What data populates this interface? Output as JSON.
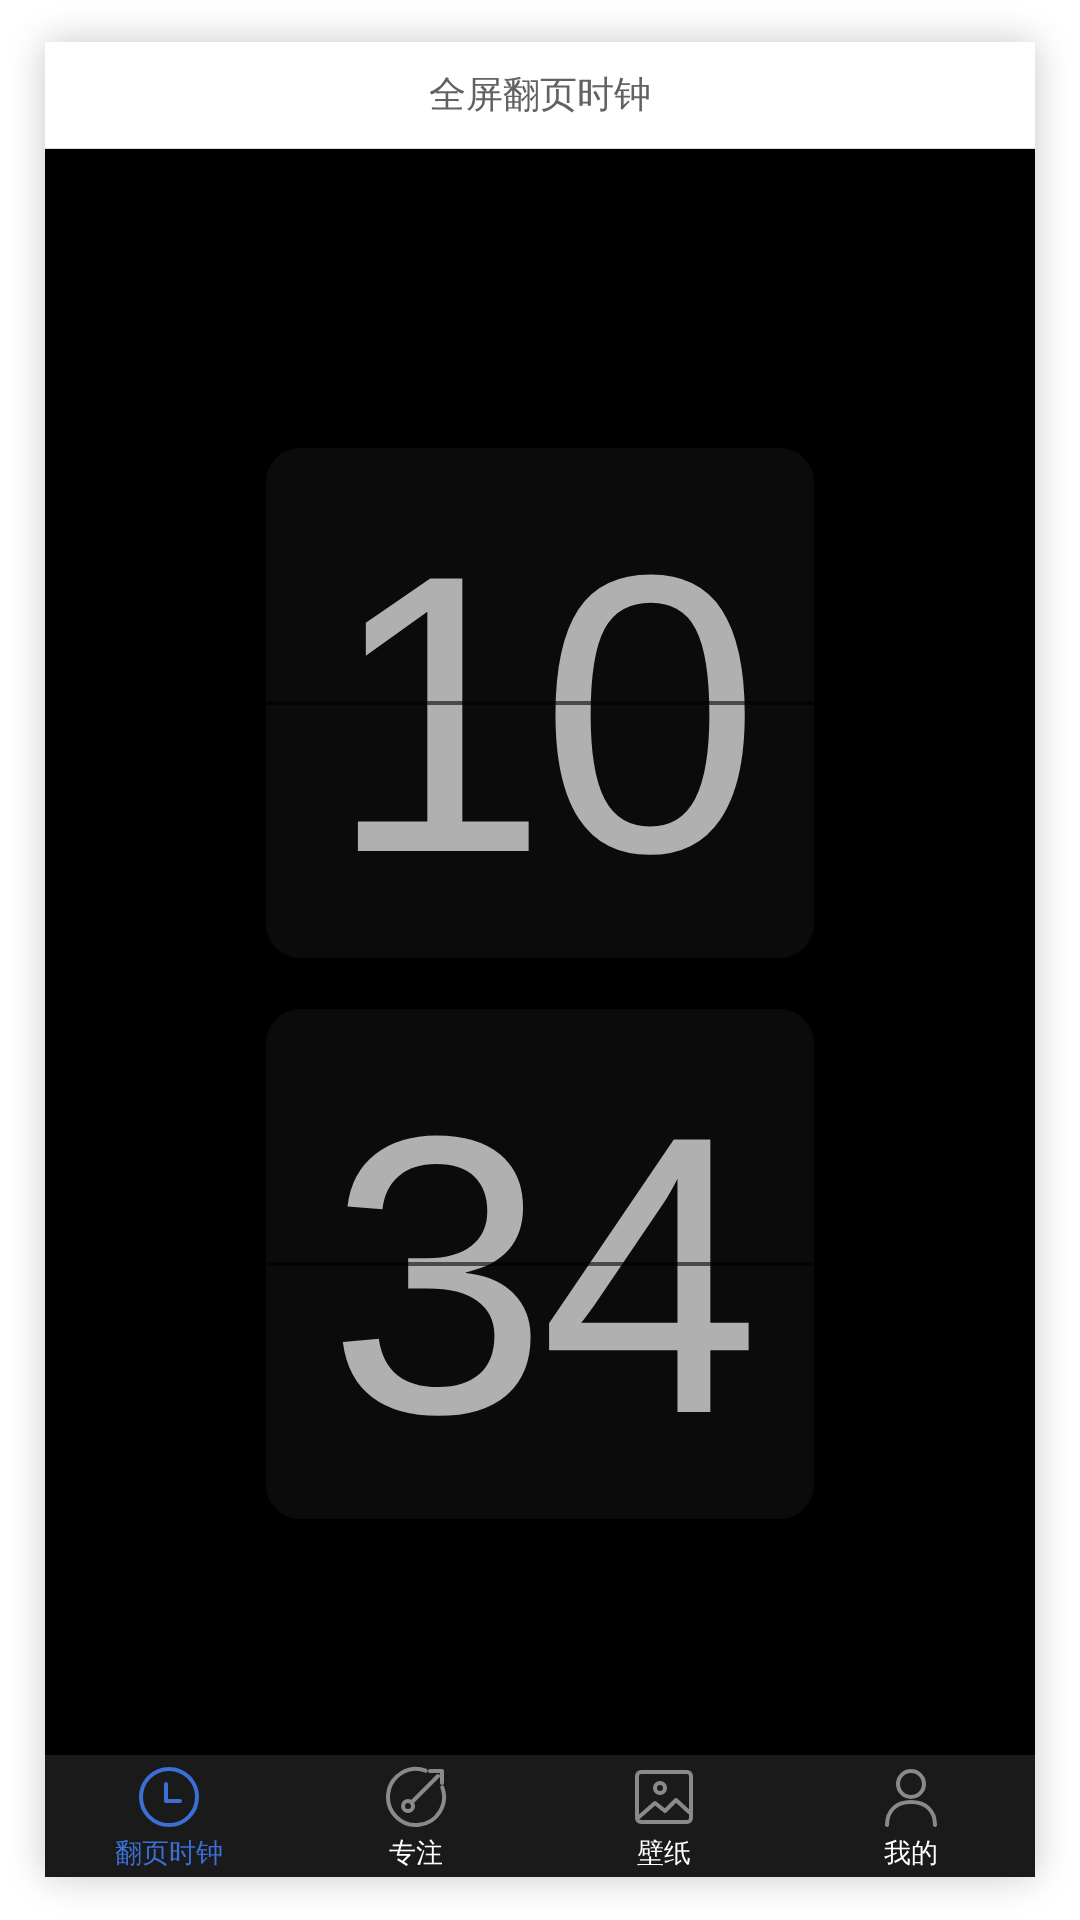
{
  "header": {
    "title": "全屏翻页时钟"
  },
  "clock": {
    "cards": [
      {
        "digits": "10"
      },
      {
        "digits": "34"
      }
    ]
  },
  "tab_bar": {
    "items": [
      {
        "label": "翻页时钟",
        "selected": true
      },
      {
        "label": "专注",
        "selected": false
      },
      {
        "label": "壁纸",
        "selected": false
      },
      {
        "label": "我的",
        "selected": false
      }
    ]
  }
}
